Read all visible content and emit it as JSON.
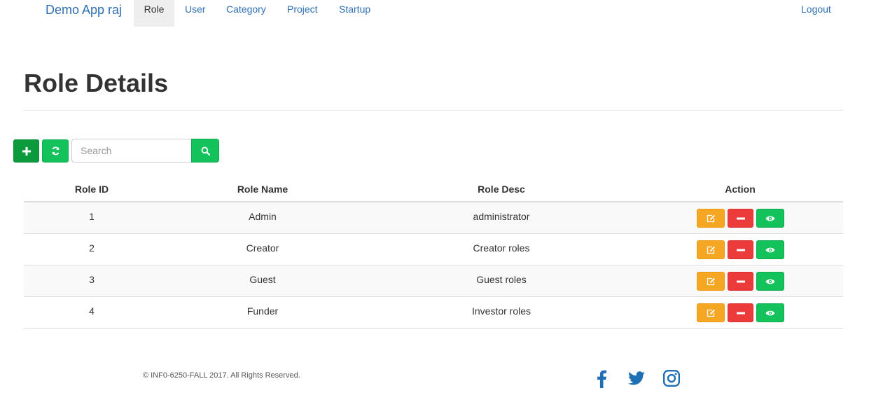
{
  "navbar": {
    "brand": "Demo App raj",
    "items": [
      {
        "label": "Role",
        "active": true
      },
      {
        "label": "User",
        "active": false
      },
      {
        "label": "Category",
        "active": false
      },
      {
        "label": "Project",
        "active": false
      },
      {
        "label": "Startup",
        "active": false
      }
    ],
    "logout": "Logout"
  },
  "page": {
    "title": "Role Details"
  },
  "toolbar": {
    "add_icon": "plus-icon",
    "refresh_icon": "refresh-icon",
    "search_placeholder": "Search",
    "search_icon": "search-icon"
  },
  "table": {
    "headers": [
      "Role ID",
      "Role Name",
      "Role Desc",
      "Action"
    ],
    "rows": [
      {
        "id": "1",
        "name": "Admin",
        "desc": "administrator"
      },
      {
        "id": "2",
        "name": "Creator",
        "desc": "Creator roles"
      },
      {
        "id": "3",
        "name": "Guest",
        "desc": "Guest roles"
      },
      {
        "id": "4",
        "name": "Funder",
        "desc": "Investor roles"
      }
    ],
    "action_icons": [
      "edit-icon",
      "minus-icon",
      "eye-icon"
    ]
  },
  "footer": {
    "copyright": "© INF0-6250-FALL 2017. All Rights Reserved.",
    "social_icons": [
      "facebook-icon",
      "twitter-icon",
      "instagram-icon"
    ]
  },
  "colors": {
    "link": "#2f6fb3",
    "success": "#13c25a",
    "success_dark": "#0b9b3c",
    "warning": "#f5a623",
    "danger": "#ec3b3b",
    "social": "#1f6fb5"
  }
}
